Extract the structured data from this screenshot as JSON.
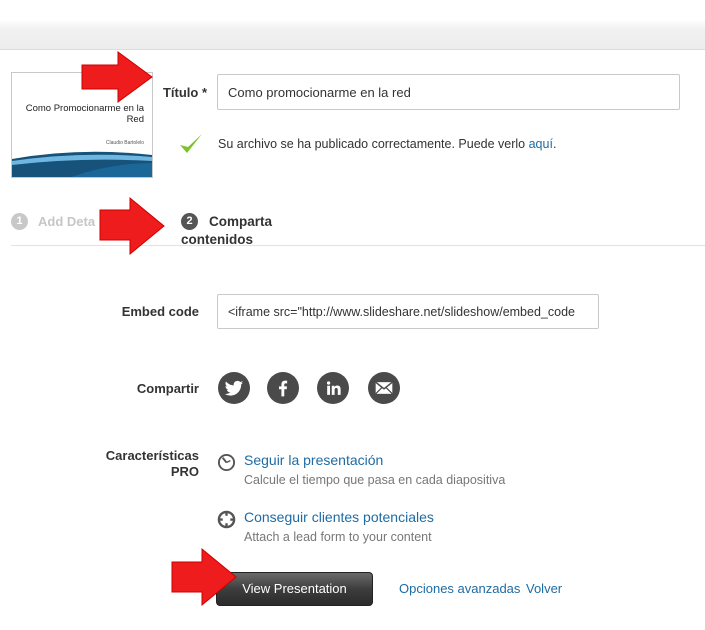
{
  "thumbnail": {
    "title": "Como Promocionarme en la Red",
    "author": "Claudio Bartolelo"
  },
  "title_field": {
    "label": "Título *",
    "value": "Como promocionarme en la red"
  },
  "success": {
    "message": "Su archivo se ha publicado correctamente. Puede verlo ",
    "link": "aquí",
    "suffix": "."
  },
  "steps": [
    {
      "number": "1",
      "label": "Add Deta"
    },
    {
      "number": "2",
      "label": "Comparta contenidos"
    }
  ],
  "embed": {
    "label": "Embed code",
    "value": "<iframe src=\"http://www.slideshare.net/slideshow/embed_code"
  },
  "share": {
    "label": "Compartir",
    "icons": [
      "twitter-icon",
      "facebook-icon",
      "linkedin-icon",
      "email-icon"
    ]
  },
  "pro": {
    "label": "Características PRO",
    "items": [
      {
        "icon": "clock-icon",
        "link": "Seguir la presentación",
        "desc": "Calcule el tiempo que pasa en cada diapositiva"
      },
      {
        "icon": "target-icon",
        "link": "Conseguir clientes potenciales",
        "desc": "Attach a lead form to your content"
      }
    ]
  },
  "actions": {
    "view": "View Presentation",
    "advanced": "Opciones avanzadas",
    "back": "Volver"
  },
  "colors": {
    "link": "#1f6ba3",
    "arrow": "#ee1c1c",
    "button": "#3d3d3d",
    "check": "#7cc42a"
  }
}
